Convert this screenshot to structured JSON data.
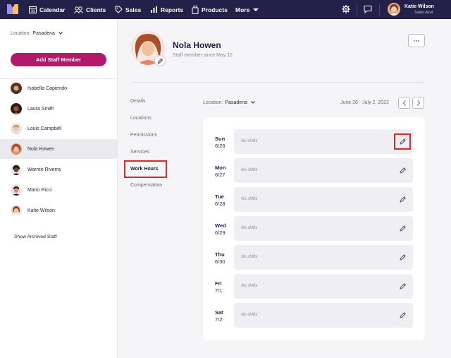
{
  "nav": {
    "items": [
      {
        "label": "Calendar"
      },
      {
        "label": "Clients"
      },
      {
        "label": "Sales"
      },
      {
        "label": "Reports"
      },
      {
        "label": "Products"
      },
      {
        "label": "More"
      }
    ],
    "user": {
      "name": "Katie Wilson",
      "company": "Salon Azul"
    }
  },
  "sidebar": {
    "location_label": "Location:",
    "location_value": "Pasadena",
    "add_button": "Add Staff Member",
    "staff": [
      {
        "name": "Isabella Capiendo"
      },
      {
        "name": "Laura Smith"
      },
      {
        "name": "Louis Campbell"
      },
      {
        "name": "Nola Howen",
        "active": true
      },
      {
        "name": "Warren Riverra"
      },
      {
        "name": "Mario Ricci"
      },
      {
        "name": "Katie Wilson"
      }
    ],
    "archived_link": "Show Archived Staff"
  },
  "profile": {
    "name": "Nola Howen",
    "since": "Staff member since May 12",
    "more_label": "···"
  },
  "tabs": [
    {
      "label": "Details"
    },
    {
      "label": "Locations"
    },
    {
      "label": "Permissions"
    },
    {
      "label": "Services"
    },
    {
      "label": "Work Hours",
      "active": true
    },
    {
      "label": "Compensation"
    }
  ],
  "schedule": {
    "location_label": "Location:",
    "location_value": "Pasadena",
    "date_range": "June 26 - July 2, 2022",
    "days": [
      {
        "day": "Sun",
        "date": "6/26",
        "shifts": "No shifts"
      },
      {
        "day": "Mon",
        "date": "6/27",
        "shifts": "No shifts"
      },
      {
        "day": "Tue",
        "date": "6/28",
        "shifts": "No shifts"
      },
      {
        "day": "Wed",
        "date": "6/29",
        "shifts": "No shifts"
      },
      {
        "day": "Thu",
        "date": "6/30",
        "shifts": "No shifts"
      },
      {
        "day": "Fri",
        "date": "7/1",
        "shifts": "No shifts"
      },
      {
        "day": "Sat",
        "date": "7/2",
        "shifts": "No shifts"
      }
    ]
  },
  "colors": {
    "nav_bg": "#23204a",
    "accent": "#b5176b",
    "highlight": "#d42a2a"
  }
}
